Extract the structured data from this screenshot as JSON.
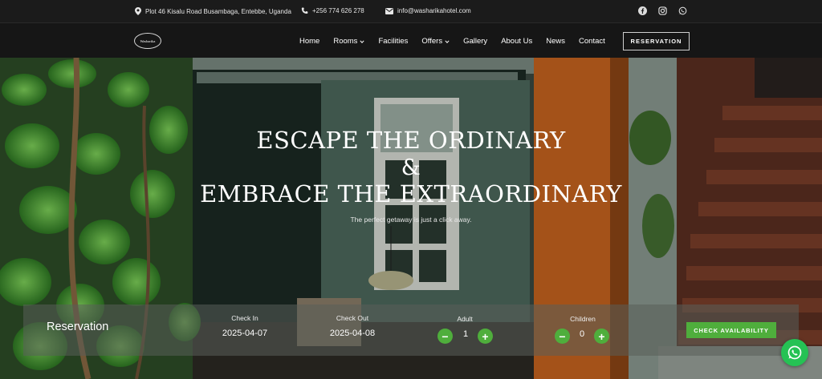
{
  "topbar": {
    "address": "Plot 46 Kisalu Road Busambaga, Entebbe, Uganda",
    "phone": "+256 774 626 278",
    "email": "info@washarikahotel.com",
    "social": [
      "facebook-icon",
      "instagram-icon",
      "whatsapp-icon"
    ]
  },
  "nav": {
    "logo_text": "Washarika",
    "items": [
      {
        "label": "Home",
        "dropdown": false
      },
      {
        "label": "Rooms",
        "dropdown": true
      },
      {
        "label": "Facilities",
        "dropdown": false
      },
      {
        "label": "Offers",
        "dropdown": true
      },
      {
        "label": "Gallery",
        "dropdown": false
      },
      {
        "label": "About Us",
        "dropdown": false
      },
      {
        "label": "News",
        "dropdown": false
      },
      {
        "label": "Contact",
        "dropdown": false
      }
    ],
    "reservation_button": "RESERVATION"
  },
  "hero": {
    "line1": "ESCAPE THE ORDINARY",
    "line2": "&",
    "line3": "EMBRACE THE EXTRAORDINARY",
    "subtitle": "The perfect getaway is just a click away."
  },
  "reservation": {
    "title": "Reservation",
    "check_in_label": "Check In",
    "check_in_value": "2025-04-07",
    "check_out_label": "Check Out",
    "check_out_value": "2025-04-08",
    "adult_label": "Adult",
    "adult_value": "1",
    "children_label": "Children",
    "children_value": "0",
    "minus": "−",
    "plus": "+",
    "check_button": "CHECK AVAILABILITY"
  },
  "colors": {
    "accent_green": "#4fae3c",
    "whatsapp_green": "#25c254",
    "dark_bar": "#161616",
    "wall_orange": "#c8651f"
  }
}
